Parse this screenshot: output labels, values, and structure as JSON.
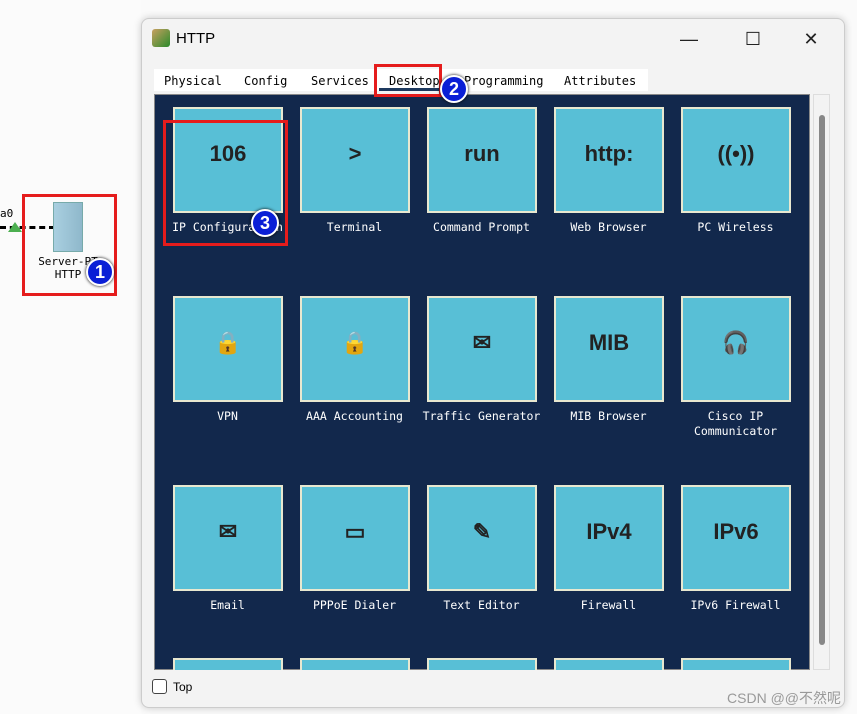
{
  "canvas": {
    "link_label": "a0",
    "device": {
      "name": "Server-PT",
      "label": "HTTP"
    }
  },
  "window": {
    "title": "HTTP",
    "minimize": "—",
    "maximize": "☐",
    "close": "✕"
  },
  "tabs": [
    "Physical",
    "Config",
    "Services",
    "Desktop",
    "Programming",
    "Attributes"
  ],
  "active_tab": "Desktop",
  "apps": [
    {
      "label": "IP Configuration",
      "icon": "ip-config-icon",
      "glyph": "106"
    },
    {
      "label": "Terminal",
      "icon": "terminal-icon",
      "glyph": ">"
    },
    {
      "label": "Command Prompt",
      "icon": "command-prompt-icon",
      "glyph": "run"
    },
    {
      "label": "Web Browser",
      "icon": "web-browser-icon",
      "glyph": "http:"
    },
    {
      "label": "PC Wireless",
      "icon": "wireless-icon",
      "glyph": "((•))"
    },
    {
      "label": "VPN",
      "icon": "vpn-icon",
      "glyph": "🔒"
    },
    {
      "label": "AAA Accounting",
      "icon": "aaa-accounting-icon",
      "glyph": "🔒"
    },
    {
      "label": "Traffic Generator",
      "icon": "traffic-generator-icon",
      "glyph": "✉"
    },
    {
      "label": "MIB Browser",
      "icon": "mib-browser-icon",
      "glyph": "MIB"
    },
    {
      "label": "Cisco IP Communicator",
      "icon": "ip-communicator-icon",
      "glyph": "🎧"
    },
    {
      "label": "Email",
      "icon": "email-icon",
      "glyph": "✉"
    },
    {
      "label": "PPPoE Dialer",
      "icon": "pppoe-dialer-icon",
      "glyph": "▭"
    },
    {
      "label": "Text Editor",
      "icon": "text-editor-icon",
      "glyph": "✎"
    },
    {
      "label": "Firewall",
      "icon": "firewall-icon",
      "glyph": "IPv4"
    },
    {
      "label": "IPv6 Firewall",
      "icon": "ipv6-firewall-icon",
      "glyph": "IPv6"
    },
    {
      "label": "",
      "icon": "app-icon",
      "glyph": ""
    },
    {
      "label": "",
      "icon": "app-icon",
      "glyph": ""
    },
    {
      "label": "",
      "icon": "app-icon",
      "glyph": ""
    },
    {
      "label": "",
      "icon": "app-icon",
      "glyph": ""
    },
    {
      "label": "",
      "icon": "app-icon",
      "glyph": ""
    }
  ],
  "footer": {
    "top_checkbox_label": "Top",
    "top_checked": false
  },
  "annotations": [
    "1",
    "2",
    "3"
  ],
  "watermark": "CSDN @@不然呢"
}
